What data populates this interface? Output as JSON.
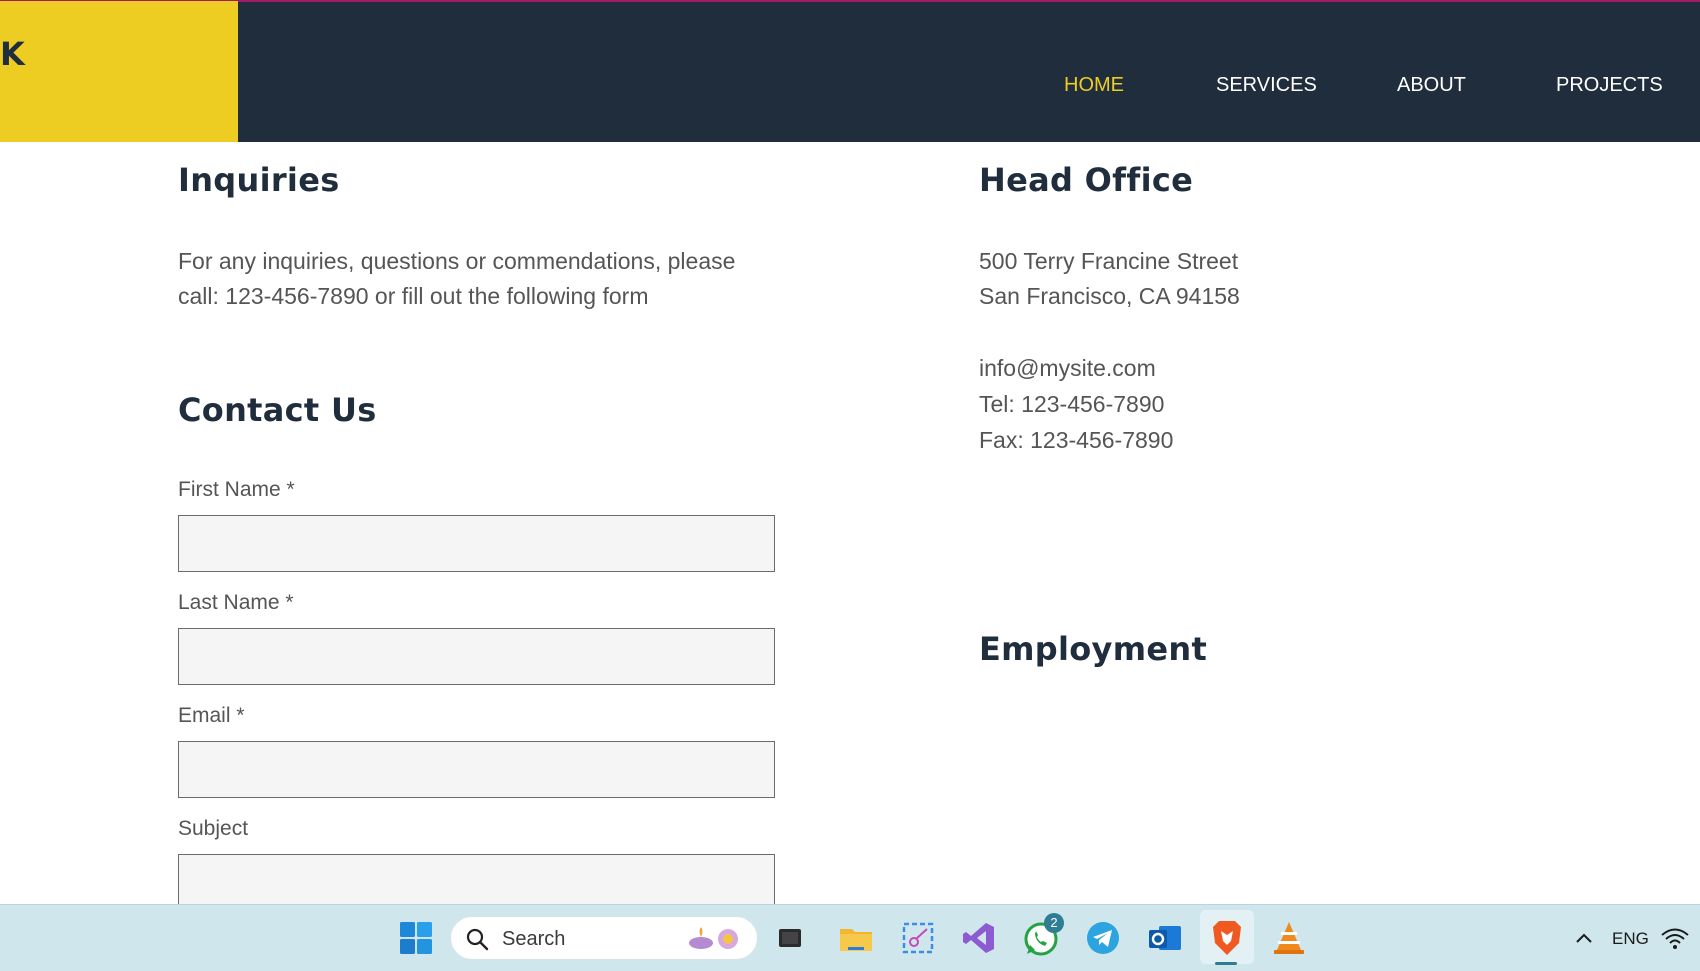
{
  "header": {
    "logo_text": "K",
    "nav": [
      {
        "label": "HOME",
        "active": true
      },
      {
        "label": "SERVICES",
        "active": false
      },
      {
        "label": "ABOUT",
        "active": false
      },
      {
        "label": "PROJECTS",
        "active": false
      }
    ],
    "colors": {
      "bar": "#1f2d3d",
      "logo_block": "#eecd22",
      "active_nav": "#eecd22"
    }
  },
  "inquiries": {
    "heading": "Inquiries",
    "line1": "For any inquiries, questions or commendations, please",
    "line2": "call: 123-456-7890 or fill out the following form"
  },
  "contact": {
    "heading": "Contact Us",
    "fields": [
      {
        "label": "First Name *",
        "value": ""
      },
      {
        "label": "Last Name *",
        "value": ""
      },
      {
        "label": "Email *",
        "value": ""
      },
      {
        "label": "Subject",
        "value": ""
      }
    ]
  },
  "head_office": {
    "heading": "Head Office",
    "address1": "500 Terry Francine Street",
    "address2": "San Francisco, CA 94158",
    "email": "info@mysite.com",
    "tel": "Tel: 123-456-7890",
    "fax": "Fax: 123-456-7890"
  },
  "employment": {
    "heading": "Employment"
  },
  "taskbar": {
    "search_placeholder": "Search",
    "whatsapp_badge": "2",
    "language": "ENG",
    "icons": [
      "windows-start-icon",
      "search-icon",
      "task-view-icon",
      "file-explorer-icon",
      "snipping-tool-icon",
      "visual-studio-icon",
      "whatsapp-icon",
      "telegram-icon",
      "outlook-icon",
      "brave-icon",
      "vlc-icon",
      "chevron-up-icon",
      "wifi-icon"
    ]
  }
}
